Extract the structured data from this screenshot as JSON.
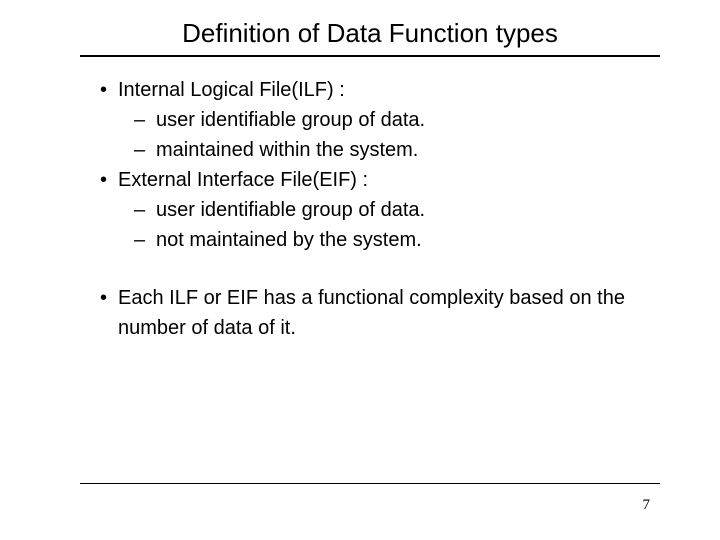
{
  "title": "Definition of Data Function types",
  "bullets": {
    "b1": "Internal Logical File(ILF) :",
    "b1_1": "user identifiable group of data.",
    "b1_2": "maintained within the system.",
    "b2": "External Interface File(EIF) :",
    "b2_1": "user identifiable group of data.",
    "b2_2": "not maintained by the system.",
    "b3": "Each ILF or EIF has a functional complexity based on the number of data of it."
  },
  "page_number": "7"
}
